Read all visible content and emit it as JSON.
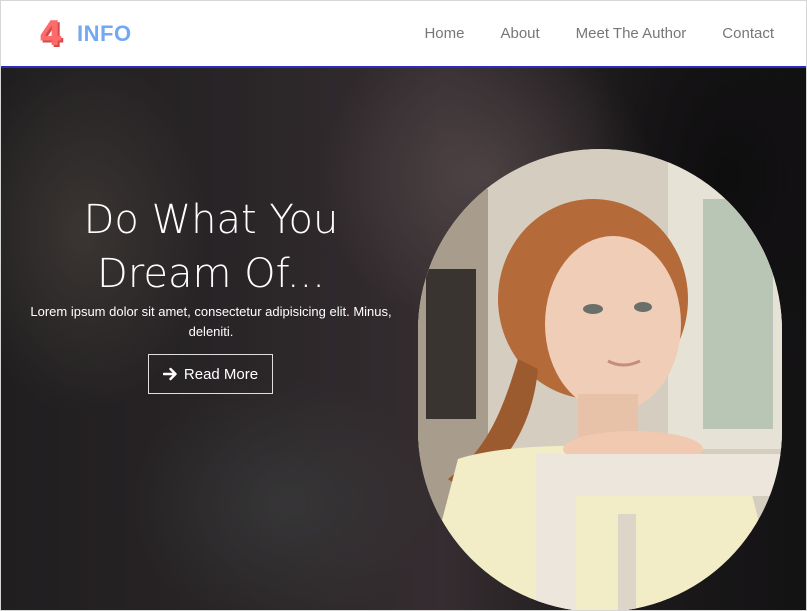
{
  "brand": {
    "mark": "4",
    "name": "INFO"
  },
  "nav": {
    "items": [
      {
        "label": "Home"
      },
      {
        "label": "About"
      },
      {
        "label": "Meet The Author"
      },
      {
        "label": "Contact"
      }
    ]
  },
  "hero": {
    "title_line1": "Do What You",
    "title_line2": "Dream Of...",
    "description": "Lorem ipsum dolor sit amet, consectetur adipisicing elit. Minus, deleniti.",
    "button_label": "Read More"
  },
  "colors": {
    "brand_mark": "#ff6b6b",
    "brand_text": "#74a8f0",
    "nav_text": "#777777",
    "header_border": "#2b2bc4"
  },
  "icons": {
    "button": "arrow-right-icon",
    "brand": "four-logo-icon"
  }
}
